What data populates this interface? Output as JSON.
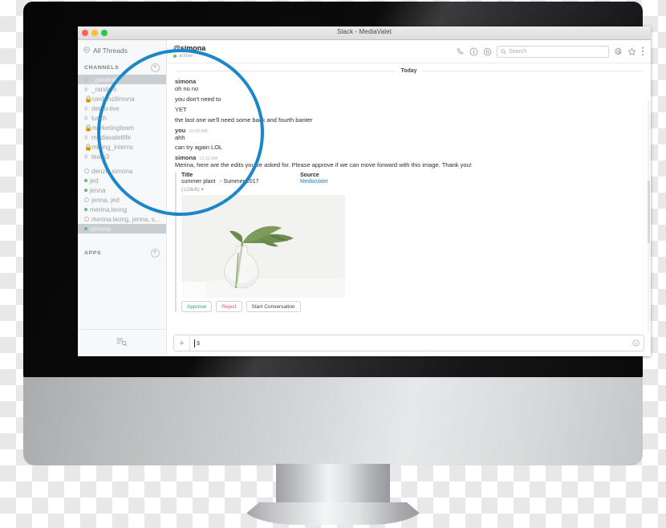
{
  "window": {
    "title": "Slack - MediaValet",
    "traffic_lights": [
      "close",
      "minimize",
      "zoom"
    ]
  },
  "sidebar": {
    "all_threads": "All Threads",
    "channels_header": "CHANNELS",
    "add_channel": "+",
    "channels": [
      {
        "label": "_general",
        "sigil": "#",
        "selected": true
      },
      {
        "label": "_random",
        "sigil": "#",
        "selected": false
      },
      {
        "label": "cardenzilimona",
        "sigil": "ὑ2",
        "selected": false
      },
      {
        "label": "demo-live",
        "sigil": "#",
        "selected": false
      },
      {
        "label": "lunch",
        "sigil": "#",
        "selected": false
      },
      {
        "label": "marketingteam",
        "sigil": "ὑ2",
        "selected": false
      },
      {
        "label": "mediavaletlife",
        "sigil": "#",
        "selected": false
      },
      {
        "label": "mkting_interns",
        "sigil": "ὑ2",
        "selected": false
      },
      {
        "label": "team3",
        "sigil": "#",
        "selected": false
      }
    ],
    "dms": [
      {
        "label": "denzil, simona",
        "presence": "group",
        "selected": false
      },
      {
        "label": "jed",
        "presence": "active",
        "selected": false
      },
      {
        "label": "jenna",
        "presence": "active",
        "selected": false
      },
      {
        "label": "jenna, jed",
        "presence": "group",
        "selected": false
      },
      {
        "label": "merina.leong",
        "presence": "active",
        "selected": false
      },
      {
        "label": "merina.leong, jenna, s...",
        "presence": "group",
        "selected": false
      },
      {
        "label": "simona",
        "presence": "active",
        "selected": true
      }
    ],
    "apps_header": "APPS",
    "add_app": "+",
    "footer_icon": "search-list-icon"
  },
  "channel_header": {
    "title": "@simona",
    "presence": "active",
    "icons": [
      "phone-icon",
      "info-icon",
      "gear-icon",
      "mention-icon",
      "star-icon",
      "kebab-menu-icon"
    ]
  },
  "search": {
    "placeholder": "Search",
    "icon": "search-icon"
  },
  "messages": {
    "day_divider": "Today",
    "items": [
      {
        "author": "simona",
        "time": "",
        "text": "oh no no"
      },
      {
        "author": "",
        "time": "",
        "text": "you don't need to"
      },
      {
        "author": "",
        "time": "",
        "text": "YET"
      },
      {
        "author": "",
        "time": "",
        "text": "the last one we'll need some back and fourth banter"
      },
      {
        "author": "you",
        "time": "10:09 AM",
        "text": "ahh"
      },
      {
        "author": "",
        "time": "",
        "text": "can try again LOL"
      },
      {
        "author": "simona",
        "time": "10:32 AM",
        "text": "Merina, here are the edits you've asked for. Please approve if we can move forward with this image. Thank you!"
      }
    ]
  },
  "attachment": {
    "title_label": "Title",
    "title_value": "summer plant",
    "title_suffix": "- Summer 2017",
    "source_label": "Source",
    "source_value": "MediaValet",
    "size": "(129kB)",
    "size_caret": "▾",
    "image_alt": "summer-plant-photo",
    "buttons": [
      {
        "label": "Approve",
        "style": "approve"
      },
      {
        "label": "Reject",
        "style": "reject"
      },
      {
        "label": "Start Conversation",
        "style": "neutral"
      }
    ]
  },
  "composer": {
    "add_icon": "plus-icon",
    "value": "$",
    "emoji_icon": "emoji-icon"
  },
  "overlay": {
    "magnifier_color": "#1b87c9"
  }
}
